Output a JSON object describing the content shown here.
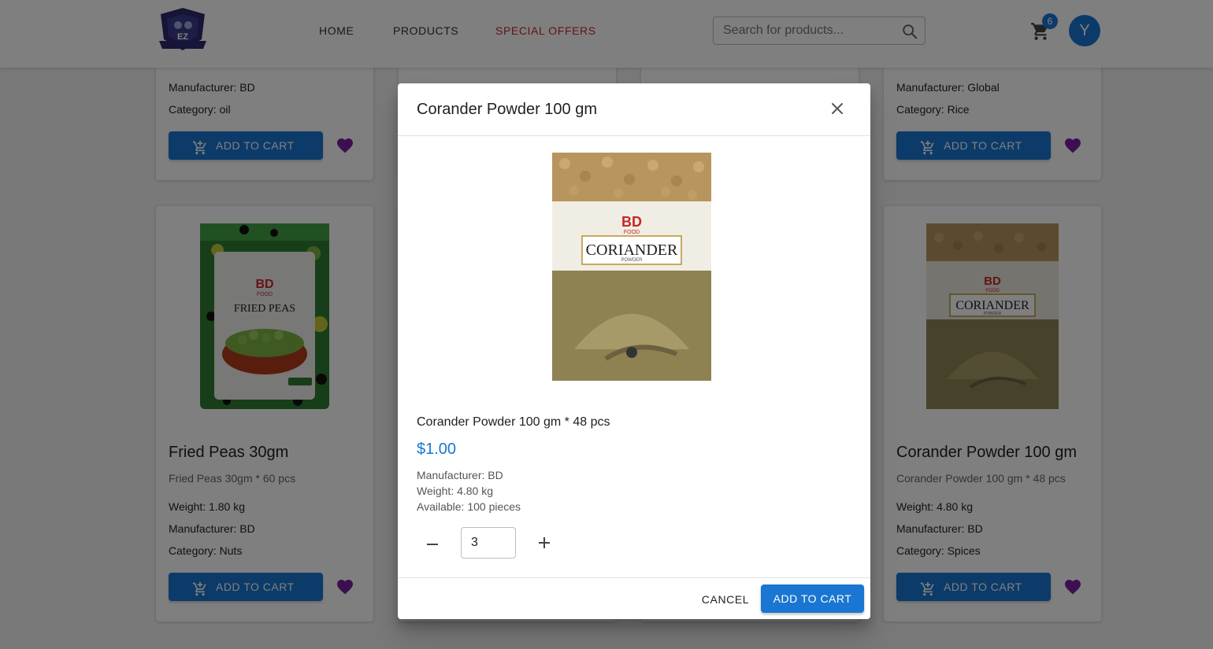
{
  "brand": {
    "logo_text": "EZ"
  },
  "nav": {
    "home": "HOME",
    "products": "PRODUCTS",
    "special_offers": "SPECIAL OFFERS"
  },
  "search": {
    "placeholder": "Search for products...",
    "value": ""
  },
  "cart": {
    "count": "6"
  },
  "user": {
    "avatar_initial": "Y"
  },
  "colors": {
    "primary": "#1976d2",
    "offers": "#c62828",
    "heart": "#7b1fa2"
  },
  "cards_top": [
    {
      "manufacturer": "Manufacturer: BD",
      "category": "Category: oil",
      "add_label": "ADD TO CART"
    },
    {
      "manufacturer": "Manufacturer: Global",
      "category": "Category: Rice",
      "add_label": "ADD TO CART"
    }
  ],
  "cards_bottom": [
    {
      "title": "Fried Peas 30gm",
      "subtitle": "Fried Peas 30gm * 60 pcs",
      "weight": "Weight: 1.80 kg",
      "manufacturer": "Manufacturer: BD",
      "category": "Category: Nuts",
      "add_label": "ADD TO CART",
      "package": {
        "brand": "BD",
        "food": "FOOD",
        "name": "FRIED PEAS"
      }
    },
    {
      "title": "Corander Powder 100 gm",
      "subtitle": "Corander Powder 100 gm * 48 pcs",
      "weight": "Weight: 4.80 kg",
      "manufacturer": "Manufacturer: BD",
      "category": "Category: Spices",
      "add_label": "ADD TO CART",
      "package": {
        "brand": "BD",
        "food": "FOOD",
        "name": "CORIANDER",
        "sub": "POWDER"
      }
    }
  ],
  "dialog": {
    "title": "Corander Powder 100 gm",
    "description": "Corander Powder 100 gm * 48 pcs",
    "price": "$1.00",
    "manufacturer": "Manufacturer: BD",
    "weight": "Weight: 4.80 kg",
    "available": "Available: 100 pieces",
    "quantity": "3",
    "cancel_label": "CANCEL",
    "add_label": "ADD TO CART",
    "package": {
      "brand": "BD",
      "food": "FOOD",
      "name": "CORIANDER",
      "sub": "POWDER"
    }
  }
}
